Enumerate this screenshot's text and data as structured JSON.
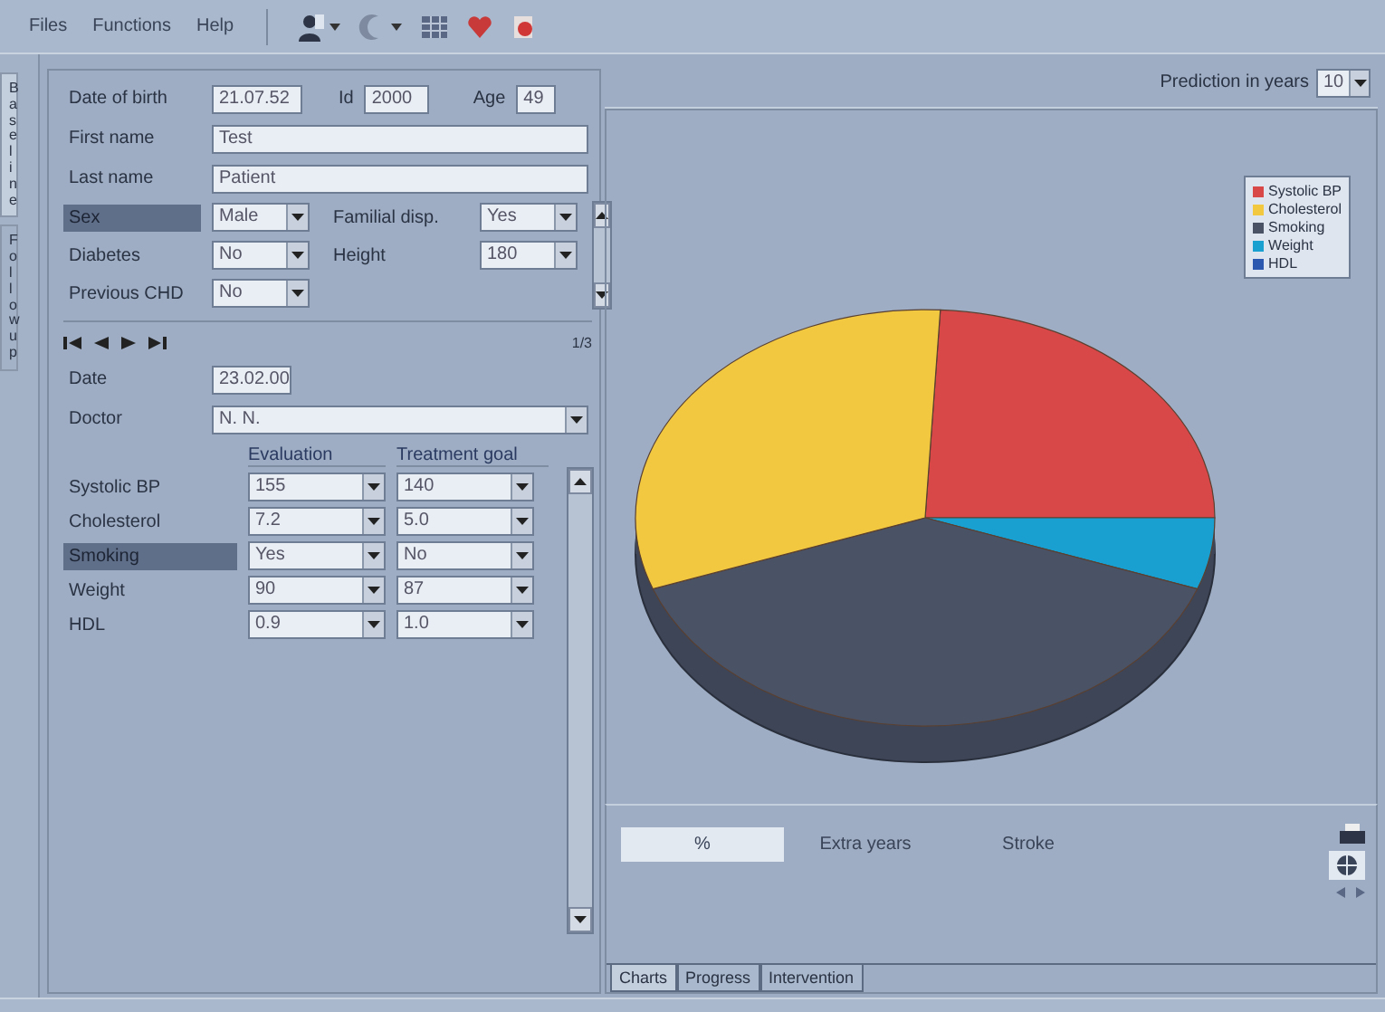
{
  "menu": [
    "Files",
    "Functions",
    "Help"
  ],
  "side_tabs": [
    {
      "label": "Baseline",
      "selected": true
    },
    {
      "label": "Followup",
      "selected": false
    }
  ],
  "patient": {
    "date_of_birth": {
      "label": "Date of birth",
      "value": "21.07.52"
    },
    "id": {
      "label": "Id",
      "value": "2000"
    },
    "age": {
      "label": "Age",
      "value": "49"
    },
    "first_name": {
      "label": "First name",
      "value": "Test"
    },
    "last_name": {
      "label": "Last name",
      "value": "Patient"
    },
    "attributes": [
      {
        "label": "Sex",
        "value": "Male",
        "selected": true
      },
      {
        "label": "Familial disp.",
        "value": "Yes",
        "selected": false
      },
      {
        "label": "Diabetes",
        "value": "No",
        "selected": false
      },
      {
        "label": "Height",
        "value": "180",
        "selected": false
      },
      {
        "label": "Previous CHD",
        "value": "No",
        "selected": false
      }
    ]
  },
  "visit": {
    "record": "1/3",
    "date": {
      "label": "Date",
      "value": "23.02.00"
    },
    "doctor": {
      "label": "Doctor",
      "value": "N. N."
    },
    "columns": [
      "Evaluation",
      "Treatment goal"
    ],
    "rows": [
      {
        "label": "Systolic BP",
        "evaluation": "155",
        "goal": "140",
        "selected": false
      },
      {
        "label": "Cholesterol",
        "evaluation": "7.2",
        "goal": "5.0",
        "selected": false
      },
      {
        "label": "Smoking",
        "evaluation": "Yes",
        "goal": "No",
        "selected": true
      },
      {
        "label": "Weight",
        "evaluation": "90",
        "goal": "87",
        "selected": false
      },
      {
        "label": "HDL",
        "evaluation": "0.9",
        "goal": "1.0",
        "selected": false
      }
    ]
  },
  "prediction": {
    "label": "Prediction in years",
    "value": "10"
  },
  "legend": [
    {
      "label": "Systolic BP",
      "color": "#d94848"
    },
    {
      "label": "Cholesterol",
      "color": "#f2c840"
    },
    {
      "label": "Smoking",
      "color": "#4a5266"
    },
    {
      "label": "Weight",
      "color": "#1aa0d0"
    },
    {
      "label": "HDL",
      "color": "#2c58b0"
    }
  ],
  "result_tabs": [
    {
      "label": "%",
      "selected": true
    },
    {
      "label": "Extra years",
      "selected": false
    },
    {
      "label": "Stroke",
      "selected": false
    }
  ],
  "view_tabs": [
    {
      "label": "Charts",
      "selected": true
    },
    {
      "label": "Progress",
      "selected": false
    },
    {
      "label": "Intervention",
      "selected": false
    }
  ]
}
